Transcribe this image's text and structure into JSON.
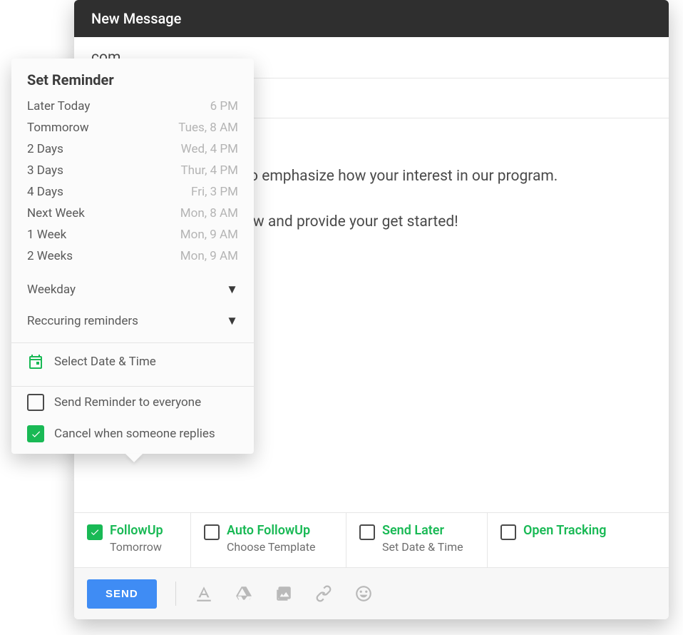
{
  "compose": {
    "title": "New Message",
    "to": "com",
    "body": {
      "greeting": "",
      "p1": "e call yesterday. I want to emphasize how your interest in our program.",
      "p2": "umentation, please review and provide your get started!"
    }
  },
  "reminder": {
    "title": "Set Reminder",
    "presets": [
      {
        "label": "Later Today",
        "time": "6 PM"
      },
      {
        "label": "Tommorow",
        "time": "Tues,  8 AM"
      },
      {
        "label": "2 Days",
        "time": "Wed, 4 PM"
      },
      {
        "label": "3 Days",
        "time": "Thur, 4 PM"
      },
      {
        "label": "4 Days",
        "time": "Fri, 3 PM"
      },
      {
        "label": "Next Week",
        "time": "Mon, 8 AM"
      },
      {
        "label": "1 Week",
        "time": "Mon, 9 AM"
      },
      {
        "label": "2 Weeks",
        "time": "Mon, 9 AM"
      }
    ],
    "dropdowns": [
      "Weekday",
      "Reccuring reminders"
    ],
    "select_date_label": "Select Date & Time",
    "checks": [
      {
        "label": "Send Reminder to everyone",
        "checked": false
      },
      {
        "label": "Cancel when someone replies",
        "checked": true
      }
    ]
  },
  "options": [
    {
      "title": "FollowUp",
      "sub": "Tomorrow",
      "checked": true
    },
    {
      "title": "Auto FollowUp",
      "sub": "Choose Template",
      "checked": false
    },
    {
      "title": "Send Later",
      "sub": "Set Date & Time",
      "checked": false
    },
    {
      "title": "Open Tracking",
      "sub": "",
      "checked": false
    }
  ],
  "toolbar": {
    "send_label": "SEND"
  },
  "colors": {
    "accent": "#19b955",
    "send": "#3f8cf4",
    "title_bar": "#2f2f2f"
  }
}
